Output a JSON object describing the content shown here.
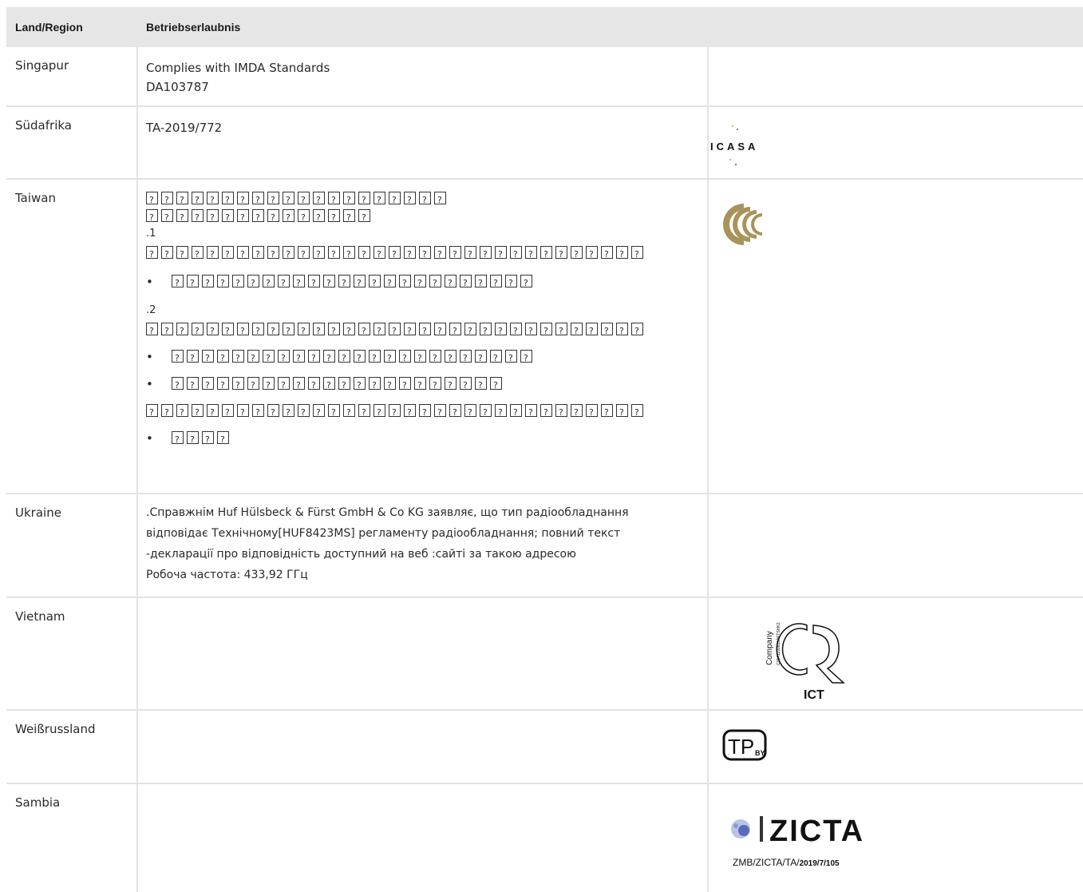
{
  "header": {
    "col_country": "Land/Region",
    "col_approval": "Betriebserlaubnis"
  },
  "rows": {
    "singapore": {
      "country": "Singapur",
      "line1": "Complies with IMDA Standards",
      "line2": "DA103787"
    },
    "south_africa": {
      "country": "Südafrika",
      "line1": "TA-2019/772",
      "logo_text": "ICASA"
    },
    "taiwan": {
      "country": "Taiwan",
      "item1": ".1",
      "item2": ".2",
      "glyph_counts": [
        20,
        15,
        33,
        24,
        33,
        24,
        22,
        33,
        4
      ]
    },
    "ukraine": {
      "country": "Ukraine",
      "line1": ".Справжнім Huf Hülsbeck & Fürst GmbH & Co KG заявляє, що тип радіообладнання",
      "line2": "відповідає Технічному[HUF8423MS] регламенту радіообладнання; повний текст",
      "line3": "-декларації про відповідність доступний на веб :сайті за такою адресою",
      "line4": "Робоча частота: 433,92 ГГц"
    },
    "vietnam": {
      "country": "Vietnam",
      "logo_company": "Company",
      "logo_code": "C0141190819AFTSHK2",
      "logo_label": "ICT"
    },
    "belarus": {
      "country": "Weißrussland",
      "logo_tp": "TP",
      "logo_by": "BY"
    },
    "zambia": {
      "country": "Sambia",
      "logo_name": "ZICTA",
      "logo_ref_a": "ZMB/ZICTA/TA/",
      "logo_ref_b": "2019/7/105"
    }
  },
  "colors": {
    "header_bg": "#e6e6e6",
    "grid": "#e3e3e3",
    "taiwan_logo": "#a8945a"
  }
}
